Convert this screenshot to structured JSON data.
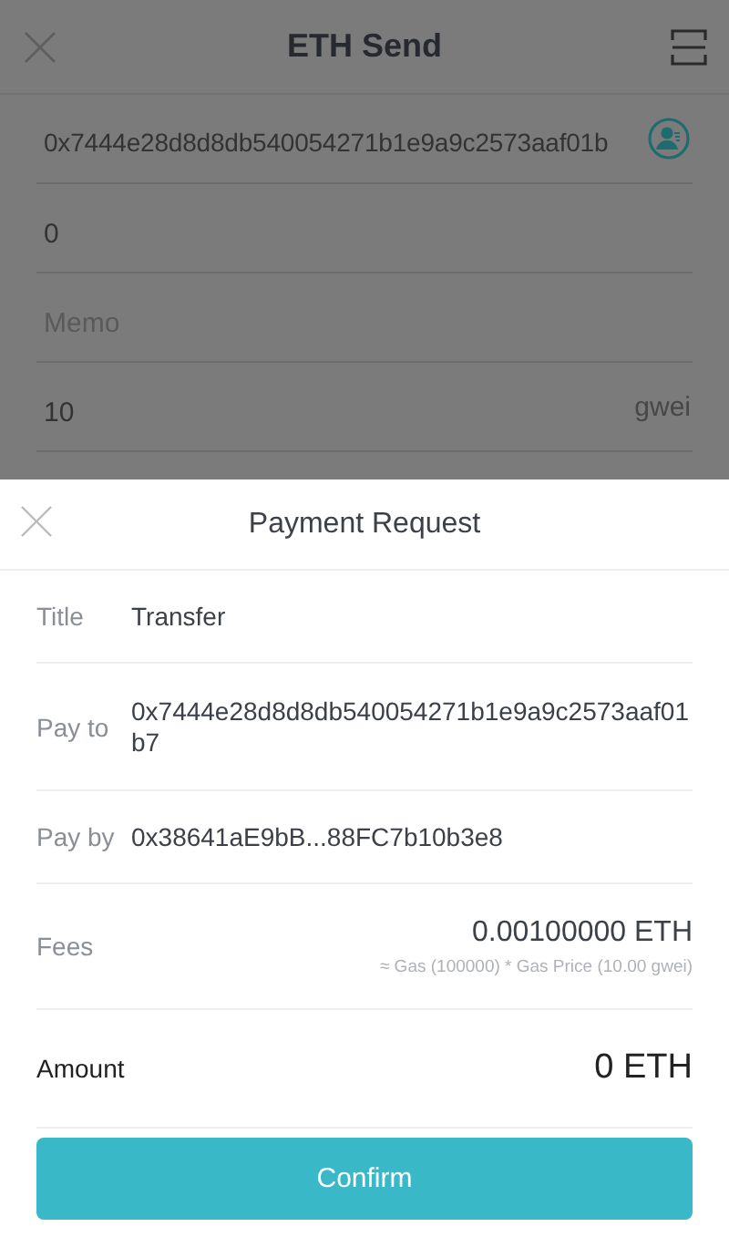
{
  "screen": {
    "title": "ETH Send",
    "fields": [
      {
        "kind": "address",
        "value": "0x7444e28d8d8db540054271b1e9a9c2573aaf01b"
      },
      {
        "kind": "plain",
        "value": "0"
      },
      {
        "kind": "plain",
        "placeholder": "Memo"
      },
      {
        "kind": "unit",
        "value": "10",
        "unit": "gwei"
      }
    ]
  },
  "sheet": {
    "title": "Payment Request",
    "rows": [
      {
        "kind": "detail",
        "label": "Title",
        "value": "Transfer"
      },
      {
        "kind": "detail",
        "label": "Pay to",
        "value": "0x7444e28d8d8db540054271b1e9a9c2573aaf01b7"
      },
      {
        "kind": "detail",
        "label": "Pay by",
        "value": "0x38641aE9bB...88FC7b10b3e8"
      },
      {
        "kind": "fee",
        "label": "Fees",
        "value": "0.00100000 ETH",
        "note": "≈ Gas (100000) * Gas Price (10.00 gwei)"
      },
      {
        "kind": "total",
        "label": "Amount",
        "value": "0 ETH"
      }
    ],
    "button": "Confirm"
  }
}
